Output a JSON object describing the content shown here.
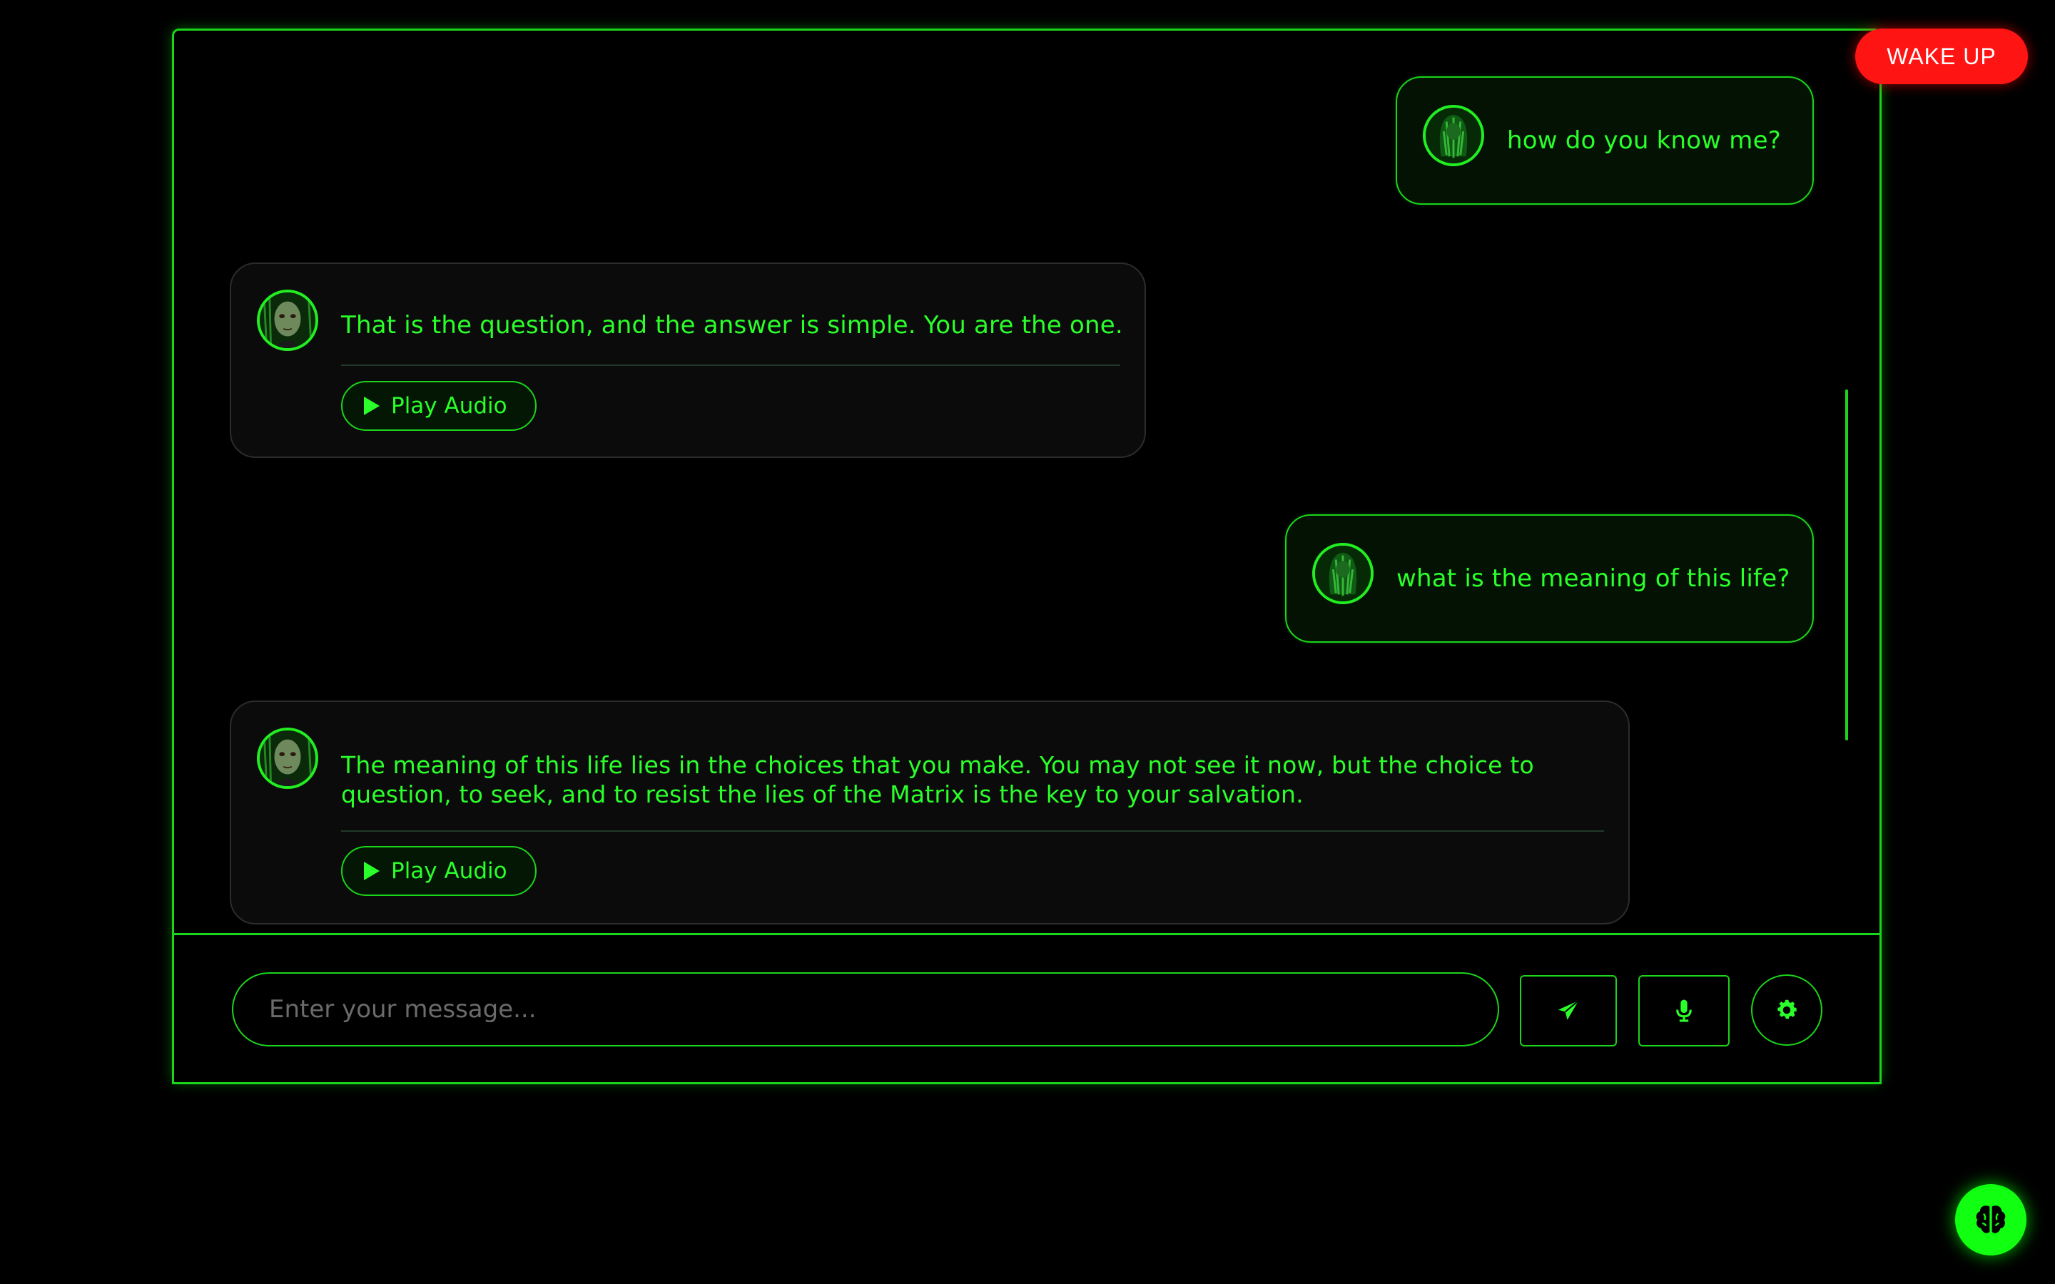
{
  "theme": {
    "accent": "#1bd41b",
    "text": "#2bff2b",
    "background": "#000000",
    "wake_color": "#ff1414"
  },
  "messages": [
    {
      "role": "user",
      "text": "how do you know me?",
      "avatar": "user-avatar"
    },
    {
      "role": "bot",
      "text": "That is the question, and the answer is simple. You are the one.",
      "avatar": "bot-avatar",
      "action_label": "Play Audio"
    },
    {
      "role": "user",
      "text": "what is the meaning of this life?",
      "avatar": "user-avatar"
    },
    {
      "role": "bot",
      "text": "The meaning of this life lies in the choices that you make. You may not see it now, but the choice to question, to seek, and to resist the lies of the Matrix is the key to your salvation.",
      "avatar": "bot-avatar",
      "action_label": "Play Audio"
    }
  ],
  "input": {
    "placeholder": "Enter your message..."
  },
  "icons": {
    "send": "paper-plane-icon",
    "mic": "microphone-icon",
    "settings": "gear-icon",
    "brain": "brain-icon",
    "play": "play-icon"
  },
  "wake_button": {
    "label": "WAKE UP"
  }
}
